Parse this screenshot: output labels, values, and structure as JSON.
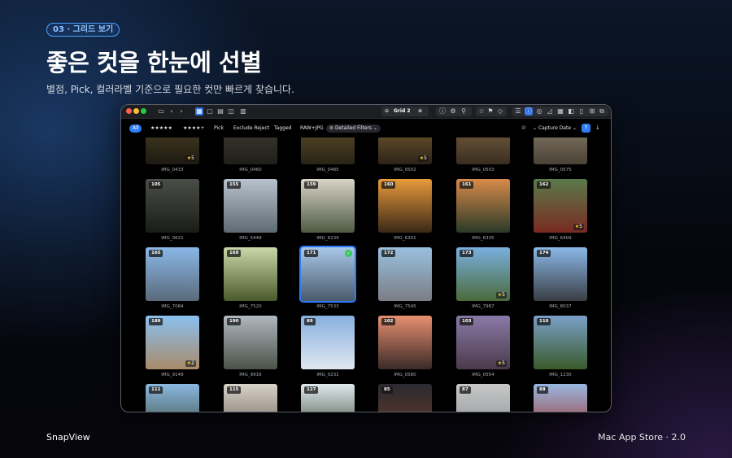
{
  "badge": "03 · 그리드 보기",
  "headline": "좋은 컷을 한눈에 선별",
  "subhead": "별점, Pick, 컬러라벨 기준으로 필요한 컷만 빠르게 찾습니다.",
  "footer": {
    "brand": "SnapView",
    "store": "Mac App Store · 2.0"
  },
  "toolbar": {
    "grid_label": "Grid 2",
    "zoom_in": "⊕",
    "zoom_out": "⊖"
  },
  "filters": [
    {
      "label": "All",
      "active": true
    },
    {
      "label": "★★★★★",
      "active": false
    },
    {
      "label": "★★★★+",
      "active": false
    },
    {
      "label": "Pick",
      "active": false
    },
    {
      "label": "Exclude Reject",
      "active": false
    },
    {
      "label": "Tagged",
      "active": false
    },
    {
      "label": "RAW+JPG",
      "active": false
    },
    {
      "label": "Detailed Filters",
      "active": false
    }
  ],
  "sort": {
    "label": "Capture Date",
    "arrow": "↑",
    "direction": "↓"
  },
  "rows": [
    [
      {
        "name": "IMG_0433",
        "num": "",
        "stars": "5",
        "c1": "#5a4a28",
        "c2": "#1c1a12"
      },
      {
        "name": "IMG_0460",
        "num": "",
        "stars": "",
        "c1": "#4a463a",
        "c2": "#201e1a"
      },
      {
        "name": "IMG_0485",
        "num": "",
        "stars": "",
        "c1": "#6b5a30",
        "c2": "#2a2416"
      },
      {
        "name": "IMG_0502",
        "num": "",
        "stars": "5",
        "c1": "#8a6a3a",
        "c2": "#2c2418"
      },
      {
        "name": "IMG_0503",
        "num": "",
        "stars": "",
        "c1": "#8a6e48",
        "c2": "#3a2e20"
      },
      {
        "name": "IMG_0575",
        "num": "",
        "stars": "",
        "c1": "#9a8e7a",
        "c2": "#4a4236"
      }
    ],
    [
      {
        "name": "IMG_0621",
        "num": "105",
        "stars": "",
        "c1": "#4a4e48",
        "c2": "#1a1c18"
      },
      {
        "name": "IMG_5449",
        "num": "155",
        "stars": "",
        "c1": "#b8c2cc",
        "c2": "#5e6a72"
      },
      {
        "name": "IMG_6239",
        "num": "159",
        "stars": "",
        "c1": "#d8d4c6",
        "c2": "#4e5a44"
      },
      {
        "name": "IMG_6301",
        "num": "160",
        "stars": "",
        "c1": "#e89a3a",
        "c2": "#3a2818"
      },
      {
        "name": "IMG_6335",
        "num": "161",
        "stars": "",
        "c1": "#d88a4a",
        "c2": "#2a3a28"
      },
      {
        "name": "IMG_6409",
        "num": "162",
        "stars": "5",
        "c1": "#5a7a4a",
        "c2": "#7a2a22"
      }
    ],
    [
      {
        "name": "IMG_7084",
        "num": "165",
        "stars": "",
        "c1": "#8ab8e8",
        "c2": "#5a6a7a"
      },
      {
        "name": "IMG_7520",
        "num": "169",
        "stars": "",
        "c1": "#c8d8a8",
        "c2": "#4a5a2a"
      },
      {
        "name": "IMG_7533",
        "num": "171",
        "stars": "",
        "c1": "#a8c8e8",
        "c2": "#4a5a6a",
        "selected": true
      },
      {
        "name": "IMG_7545",
        "num": "172",
        "stars": "",
        "c1": "#9ac0e0",
        "c2": "#7a7e84"
      },
      {
        "name": "IMG_7987",
        "num": "173",
        "stars": "5",
        "c1": "#7ab0e0",
        "c2": "#4a6a3a"
      },
      {
        "name": "IMG_8037",
        "num": "174",
        "stars": "",
        "c1": "#8ab8e8",
        "c2": "#3a3e44"
      }
    ],
    [
      {
        "name": "IMG_9149",
        "num": "189",
        "stars": "2",
        "c1": "#8ac0f0",
        "c2": "#a88a6a"
      },
      {
        "name": "IMG_9916",
        "num": "190",
        "stars": "",
        "c1": "#b0b8c0",
        "c2": "#4a5248"
      },
      {
        "name": "IMG_0231",
        "num": "89",
        "stars": "",
        "c1": "#88b0e0",
        "c2": "#e0e8f0"
      },
      {
        "name": "IMG_0580",
        "num": "102",
        "stars": "",
        "c1": "#e89070",
        "c2": "#3a2a28"
      },
      {
        "name": "IMG_0554",
        "num": "103",
        "stars": "5",
        "c1": "#8a7aa8",
        "c2": "#4a3a4a"
      },
      {
        "name": "IMG_1230",
        "num": "110",
        "stars": "",
        "c1": "#7aa0c8",
        "c2": "#3a5a2a"
      }
    ],
    [
      {
        "name": "",
        "num": "111",
        "stars": "",
        "c1": "#8ab8e0",
        "c2": "#3a4a3a"
      },
      {
        "name": "",
        "num": "115",
        "stars": "",
        "c1": "#d8d2c8",
        "c2": "#6a5e54"
      },
      {
        "name": "",
        "num": "127",
        "stars": "",
        "c1": "#e0e8f0",
        "c2": "#3a4a30"
      },
      {
        "name": "",
        "num": "85",
        "stars": "",
        "c1": "#2a2a30",
        "c2": "#6a3a2a"
      },
      {
        "name": "",
        "num": "87",
        "stars": "",
        "c1": "#c8c8c8",
        "c2": "#8a8e92"
      },
      {
        "name": "",
        "num": "88",
        "stars": "",
        "c1": "#98b8e0",
        "c2": "#a0302a"
      }
    ]
  ]
}
